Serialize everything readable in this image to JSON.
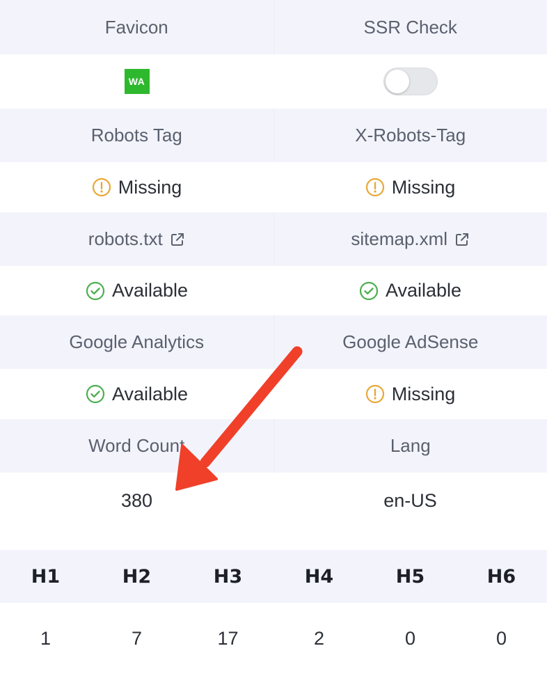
{
  "rows": [
    {
      "left": {
        "label": "Favicon"
      },
      "right": {
        "label": "SSR Check"
      }
    },
    {
      "left": {
        "favicon_text": "WA"
      },
      "right": {
        "toggle_state": "off"
      }
    },
    {
      "left": {
        "label": "Robots Tag"
      },
      "right": {
        "label": "X-Robots-Tag"
      }
    },
    {
      "left": {
        "status": "Missing",
        "icon": "warning-circle-icon"
      },
      "right": {
        "status": "Missing",
        "icon": "warning-circle-icon"
      }
    },
    {
      "left": {
        "label": "robots.txt",
        "icon": "external-link-icon"
      },
      "right": {
        "label": "sitemap.xml",
        "icon": "external-link-icon"
      }
    },
    {
      "left": {
        "status": "Available",
        "icon": "check-circle-icon"
      },
      "right": {
        "status": "Available",
        "icon": "check-circle-icon"
      }
    },
    {
      "left": {
        "label": "Google Analytics"
      },
      "right": {
        "label": "Google AdSense"
      }
    },
    {
      "left": {
        "status": "Available",
        "icon": "check-circle-icon"
      },
      "right": {
        "status": "Missing",
        "icon": "warning-circle-icon"
      }
    },
    {
      "left": {
        "label": "Word Count"
      },
      "right": {
        "label": "Lang"
      }
    },
    {
      "left": {
        "value": "380"
      },
      "right": {
        "value": "en-US"
      }
    }
  ],
  "headings": {
    "labels": [
      "H1",
      "H2",
      "H3",
      "H4",
      "H5",
      "H6"
    ],
    "counts": [
      "1",
      "7",
      "17",
      "2",
      "0",
      "0"
    ]
  },
  "colors": {
    "header_bg": "#f3f4fb",
    "warning": "#e8a838",
    "success": "#4caf50",
    "favicon_green": "#2eb82e",
    "annotation_arrow": "#f0402a"
  }
}
